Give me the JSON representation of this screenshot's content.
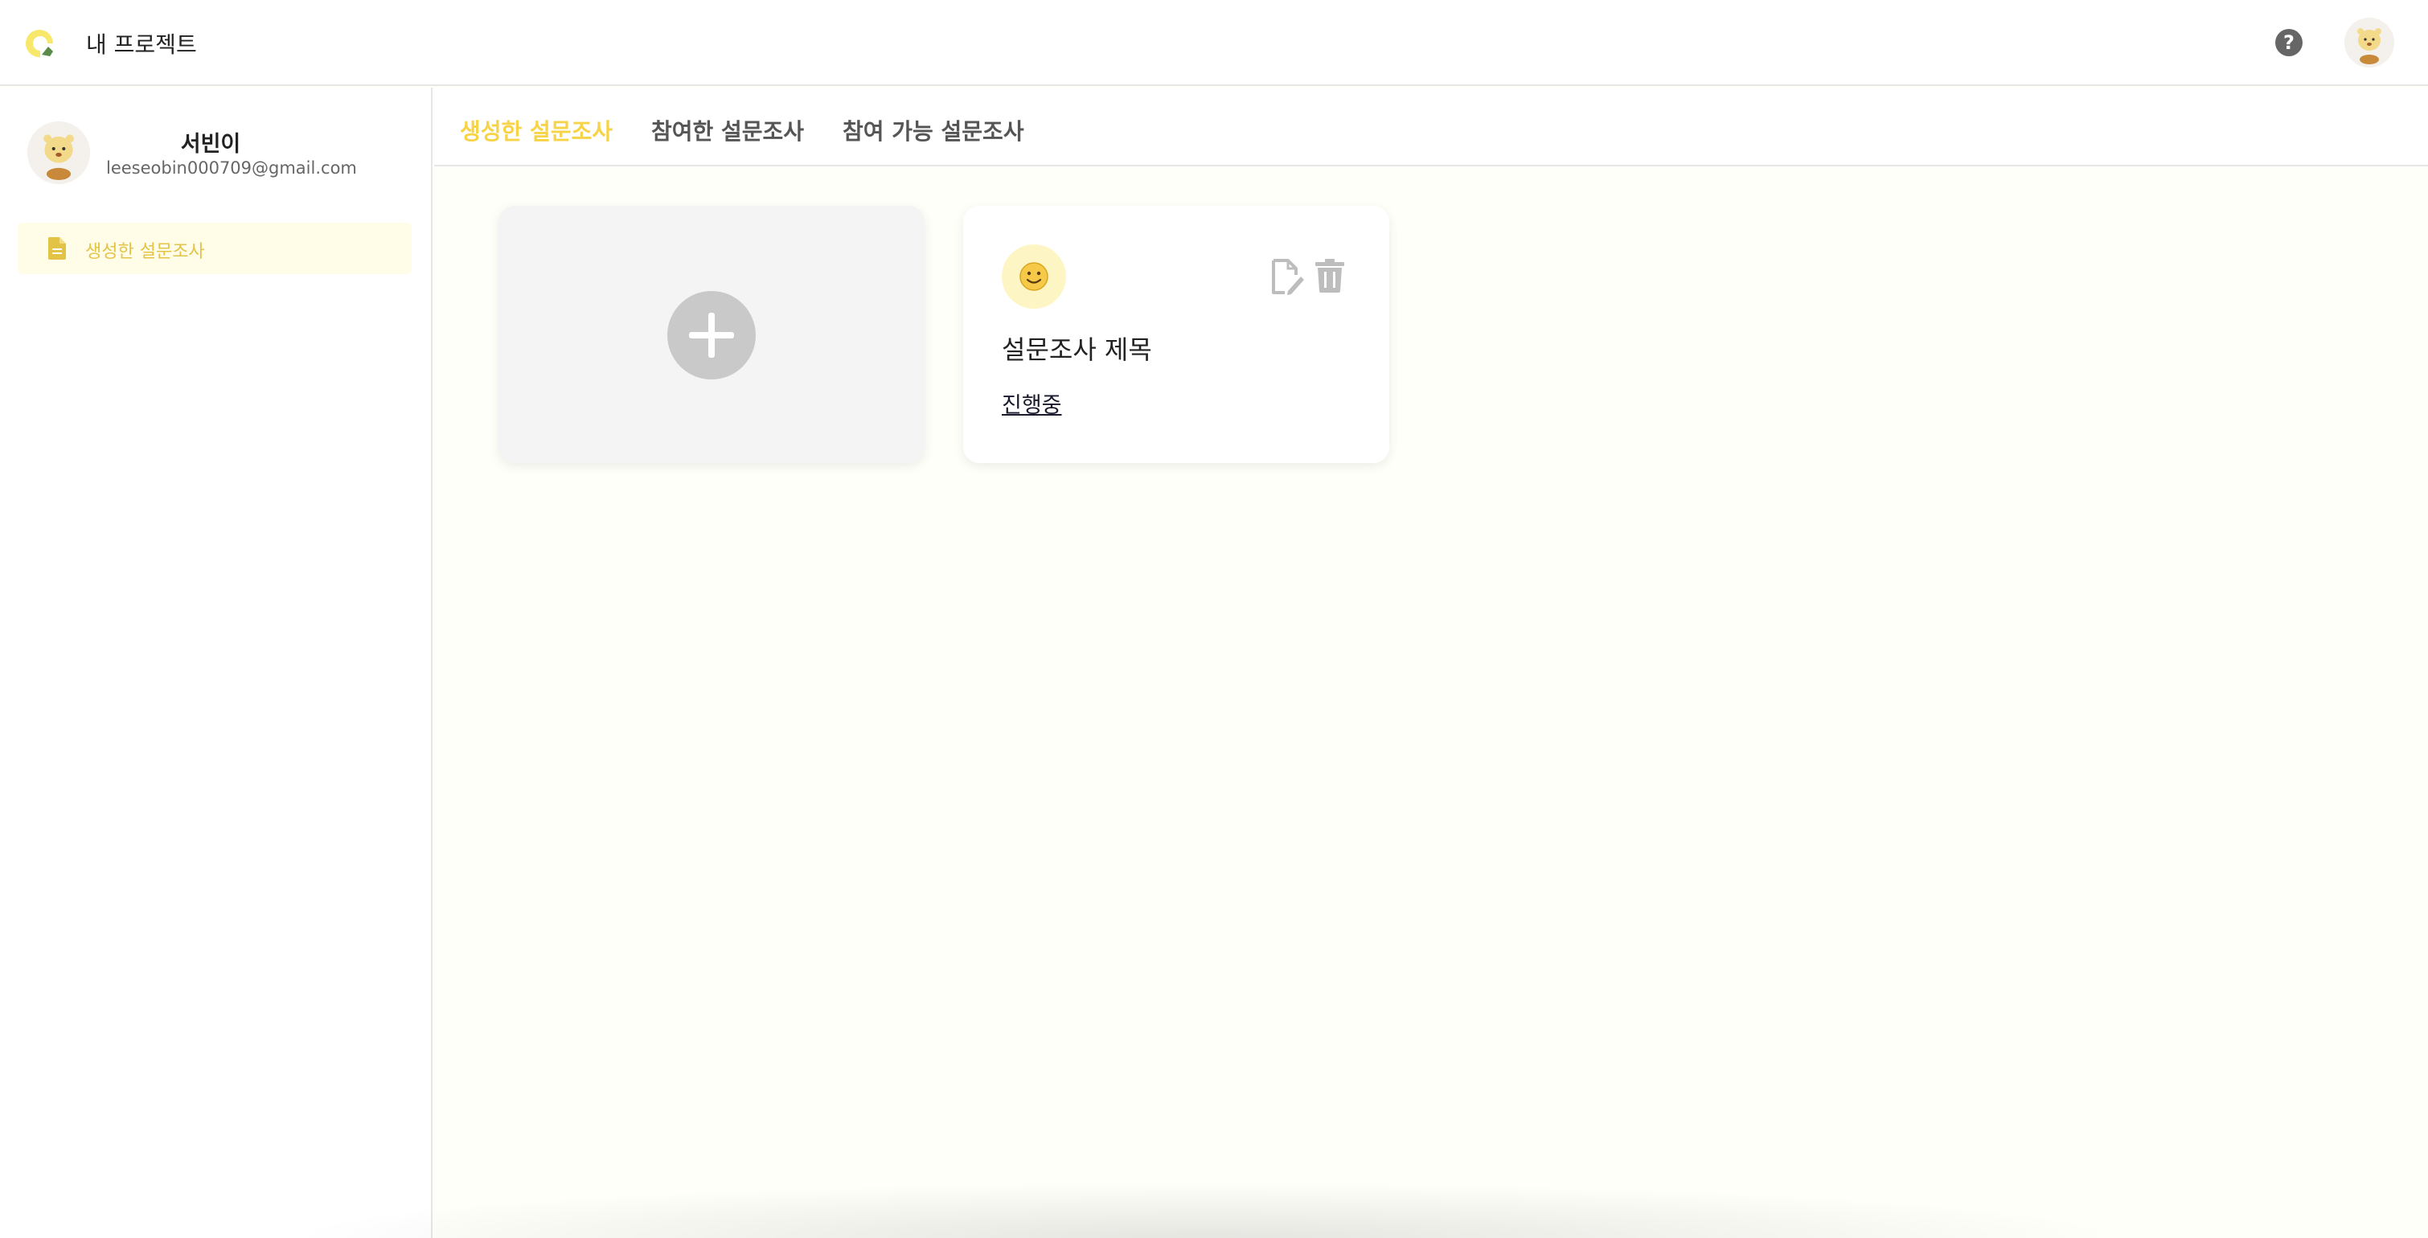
{
  "header": {
    "title": "내 프로젝트",
    "logo_icon": "logo-icon",
    "help_icon": "question-circle-icon",
    "help_symbol": "?",
    "avatar_icon": "user-avatar"
  },
  "sidebar": {
    "profile": {
      "name": "서빈이",
      "email": "leeseobin000709@gmail.com"
    },
    "items": [
      {
        "label": "생성한 설문조사",
        "icon": "document-icon",
        "active": true
      }
    ]
  },
  "tabs": [
    {
      "label": "생성한 설문조사",
      "active": true
    },
    {
      "label": "참여한 설문조사",
      "active": false
    },
    {
      "label": "참여 가능 설문조사",
      "active": false
    }
  ],
  "cards": {
    "add": {
      "icon": "plus-icon"
    },
    "survey": {
      "emoji": "smiley-icon",
      "title": "설문조사 제목",
      "status": "진행중",
      "actions": [
        "edit-icon",
        "trash-icon"
      ]
    }
  },
  "colors": {
    "accent": "#f7d348",
    "accent_bg": "#fffce8",
    "page_bg": "#fffffa",
    "emoji_bg": "#fdf6c4"
  }
}
